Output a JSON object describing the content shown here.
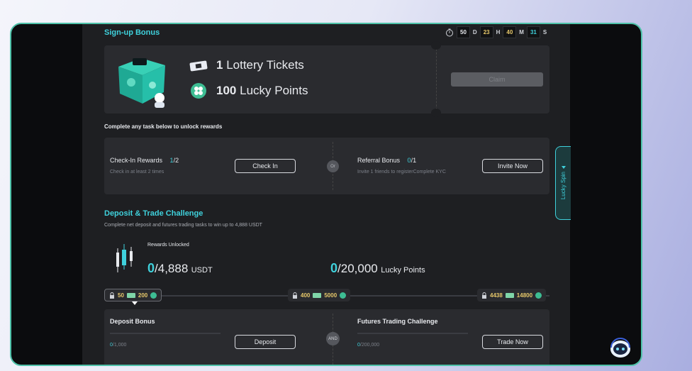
{
  "signup": {
    "title": "Sign-up Bonus",
    "timer": [
      {
        "value": "50",
        "unit": "D",
        "color": "#e8eaee"
      },
      {
        "value": "23",
        "unit": "H",
        "color": "#e7c86a"
      },
      {
        "value": "40",
        "unit": "M",
        "color": "#e7c86a"
      },
      {
        "value": "31",
        "unit": "S",
        "color": "#3fd1dc"
      }
    ],
    "reward1_amount": "1",
    "reward1_label": "Lottery Tickets",
    "reward2_amount": "100",
    "reward2_label": "Lucky Points",
    "claim_label": "Claim"
  },
  "tasks": {
    "intro": "Complete any task below to unlock rewards",
    "checkin_title": "Check-In Rewards",
    "checkin_done": "1",
    "checkin_total": "/2",
    "checkin_desc": "Check in at least 2 times",
    "checkin_button": "Check In",
    "or_label": "Or",
    "referral_title": "Referral Bonus",
    "referral_done": "0",
    "referral_total": "/1",
    "referral_desc": "Invite 1 friends to registerComplete KYC",
    "referral_button": "Invite Now"
  },
  "lucky_spin": "Lucky Spin",
  "deposit_trade": {
    "title": "Deposit & Trade Challenge",
    "subtitle": "Complete net deposit and futures trading tasks to win up to 4,888 USDT",
    "rewards_unlocked": "Rewards Unlocked",
    "usdt_current": "0",
    "usdt_total": "/4,888",
    "usdt_unit": "USDT",
    "points_current": "0",
    "points_total": "/20,000",
    "points_unit": "Lucky Points",
    "milestones": [
      {
        "a": "50",
        "b": "200"
      },
      {
        "a": "400",
        "b": "5000"
      },
      {
        "a": "4438",
        "b": "14800"
      }
    ],
    "deposit_title": "Deposit Bonus",
    "deposit_done": "0",
    "deposit_total": "/1,000",
    "deposit_button": "Deposit",
    "and_label": "AND",
    "futures_title": "Futures Trading Challenge",
    "futures_done": "0",
    "futures_total": "/200,000",
    "futures_button": "Trade Now"
  }
}
